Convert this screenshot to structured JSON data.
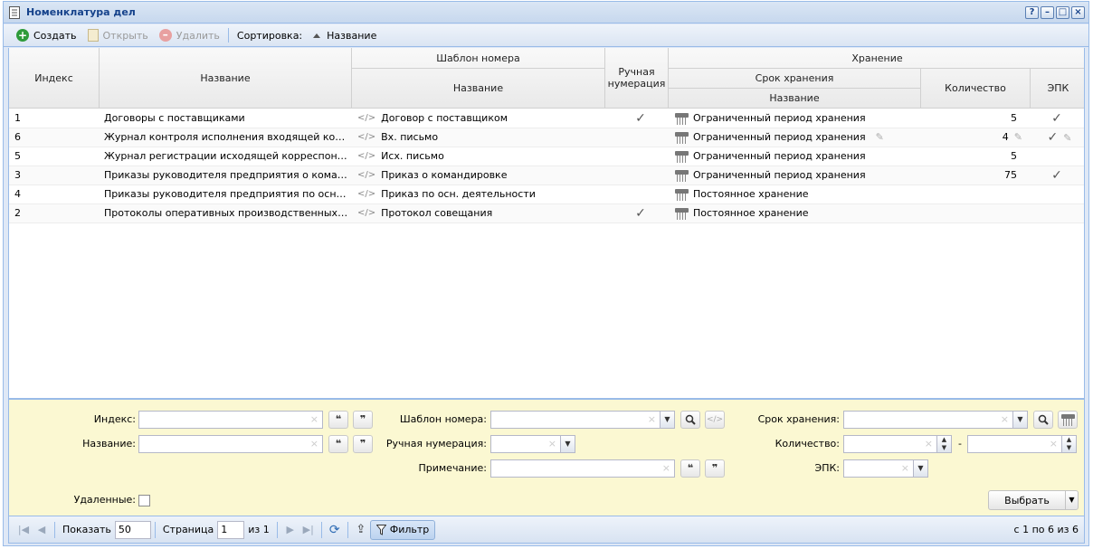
{
  "window": {
    "title": "Номенклатура дел",
    "tools": [
      "?",
      "–",
      "□",
      "×"
    ]
  },
  "toolbar": {
    "create": "Создать",
    "open": "Открыть",
    "delete": "Удалить",
    "sort_label": "Сортировка:",
    "sort_value": "Название"
  },
  "grid": {
    "headers": {
      "index": "Индекс",
      "name": "Название",
      "template_group": "Шаблон номера",
      "template_name": "Название",
      "manual": "Ручная нумерация",
      "storage_group": "Хранение",
      "term_group": "Срок хранения",
      "term_name": "Название",
      "quantity": "Количество",
      "epk": "ЭПК"
    },
    "rows": [
      {
        "index": "1",
        "name": "Договоры с поставщиками",
        "template_code": "</>",
        "template": "Договор с поставщиком",
        "manual": "✓",
        "term": "Ограниченный период хранения",
        "term_edit": "",
        "quantity": "5",
        "qty_edit": "",
        "epk": "✓",
        "epk_edit": ""
      },
      {
        "index": "6",
        "name": "Журнал контроля исполнения входящей корреспо...",
        "template_code": "</>",
        "template": "Вх. письмо",
        "manual": "",
        "term": "Ограниченный период хранения",
        "term_edit": "✎",
        "quantity": "4",
        "qty_edit": "✎",
        "epk": "✓",
        "epk_edit": "✎"
      },
      {
        "index": "5",
        "name": "Журнал регистрации исходящей корреспонденции",
        "template_code": "</>",
        "template": "Исх. письмо",
        "manual": "",
        "term": "Ограниченный период хранения",
        "term_edit": "",
        "quantity": "5",
        "qty_edit": "",
        "epk": "",
        "epk_edit": ""
      },
      {
        "index": "3",
        "name": "Приказы руководителя предприятия о командиро...",
        "template_code": "</>",
        "template": "Приказ о командировке",
        "manual": "",
        "term": "Ограниченный период хранения",
        "term_edit": "",
        "quantity": "75",
        "qty_edit": "",
        "epk": "✓",
        "epk_edit": ""
      },
      {
        "index": "4",
        "name": "Приказы руководителя предприятия по основной ...",
        "template_code": "</>",
        "template": "Приказ по осн. деятельности",
        "manual": "",
        "term": "Постоянное хранение",
        "term_edit": "",
        "quantity": "",
        "qty_edit": "",
        "epk": "",
        "epk_edit": ""
      },
      {
        "index": "2",
        "name": "Протоколы оперативных производственных сове...",
        "template_code": "</>",
        "template": "Протокол совещания",
        "manual": "✓",
        "term": "Постоянное хранение",
        "term_edit": "",
        "quantity": "",
        "qty_edit": "",
        "epk": "",
        "epk_edit": ""
      }
    ]
  },
  "filter": {
    "index_label": "Индекс:",
    "name_label": "Название:",
    "template_label": "Шаблон номера:",
    "manual_label": "Ручная нумерация:",
    "note_label": "Примечание:",
    "term_label": "Срок хранения:",
    "quantity_label": "Количество:",
    "quantity_dash": "-",
    "epk_label": "ЭПК:",
    "deleted_label": "Удаленные:",
    "select_button": "Выбрать",
    "quote_open": "❝",
    "quote_close": "❞",
    "clear": "×",
    "code": "</>"
  },
  "pager": {
    "show_label": "Показать",
    "page_size": "50",
    "page_label": "Страница",
    "page": "1",
    "of_label": "из 1",
    "filter_button": "Фильтр",
    "status": "с 1 по 6 из 6"
  }
}
